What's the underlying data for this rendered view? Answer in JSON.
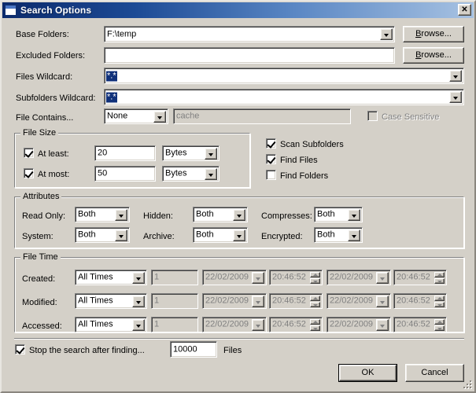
{
  "window": {
    "title": "Search Options",
    "icon": "window-icon",
    "close_label": "✕"
  },
  "fields": {
    "base_folders": {
      "label": "Base Folders:",
      "value": "F:\\temp"
    },
    "excluded_folders": {
      "label": "Excluded Folders:",
      "value": ""
    },
    "files_wildcard": {
      "label": "Files Wildcard:",
      "value": "*.*"
    },
    "subfolders_wildcard": {
      "label": "Subfolders Wildcard:",
      "value": "*.*"
    },
    "file_contains": {
      "label": "File Contains...",
      "mode": "None",
      "text_placeholder": "cache",
      "case_sensitive_label": "Case Sensitive",
      "case_sensitive_checked": false
    },
    "browse_1": "Browse...",
    "browse_2": "Browse..."
  },
  "file_size": {
    "caption": "File Size",
    "at_least": {
      "label": "At least:",
      "checked": true,
      "value": "20",
      "unit": "Bytes"
    },
    "at_most": {
      "label": "At most:",
      "checked": true,
      "value": "50",
      "unit": "Bytes"
    }
  },
  "scan_options": [
    {
      "label": "Scan Subfolders",
      "checked": true
    },
    {
      "label": "Find Files",
      "checked": true
    },
    {
      "label": "Find Folders",
      "checked": false
    }
  ],
  "attributes": {
    "caption": "Attributes",
    "items": [
      {
        "label": "Read Only:",
        "value": "Both"
      },
      {
        "label": "Hidden:",
        "value": "Both"
      },
      {
        "label": "Compresses:",
        "value": "Both"
      },
      {
        "label": "System:",
        "value": "Both"
      },
      {
        "label": "Archive:",
        "value": "Both"
      },
      {
        "label": "Encrypted:",
        "value": "Both"
      }
    ]
  },
  "file_time": {
    "caption": "File Time",
    "rows": [
      {
        "label": "Created:",
        "mode": "All Times",
        "count": "1",
        "date_from": "22/02/2009",
        "time_from": "20:46:52",
        "date_to": "22/02/2009",
        "time_to": "20:46:52"
      },
      {
        "label": "Modified:",
        "mode": "All Times",
        "count": "1",
        "date_from": "22/02/2009",
        "time_from": "20:46:52",
        "date_to": "22/02/2009",
        "time_to": "20:46:52"
      },
      {
        "label": "Accessed:",
        "mode": "All Times",
        "count": "1",
        "date_from": "22/02/2009",
        "time_from": "20:46:52",
        "date_to": "22/02/2009",
        "time_to": "20:46:52"
      }
    ]
  },
  "stop_search": {
    "label": "Stop the search after finding...",
    "checked": true,
    "value": "10000",
    "unit": "Files"
  },
  "buttons": {
    "ok": "OK",
    "cancel": "Cancel"
  },
  "colors": {
    "dialog_face": "#d4d0c8",
    "title_dark": "#0b2a6b",
    "title_light": "#a7c2e2",
    "selection": "#10317a",
    "disabled_text": "#808080"
  }
}
